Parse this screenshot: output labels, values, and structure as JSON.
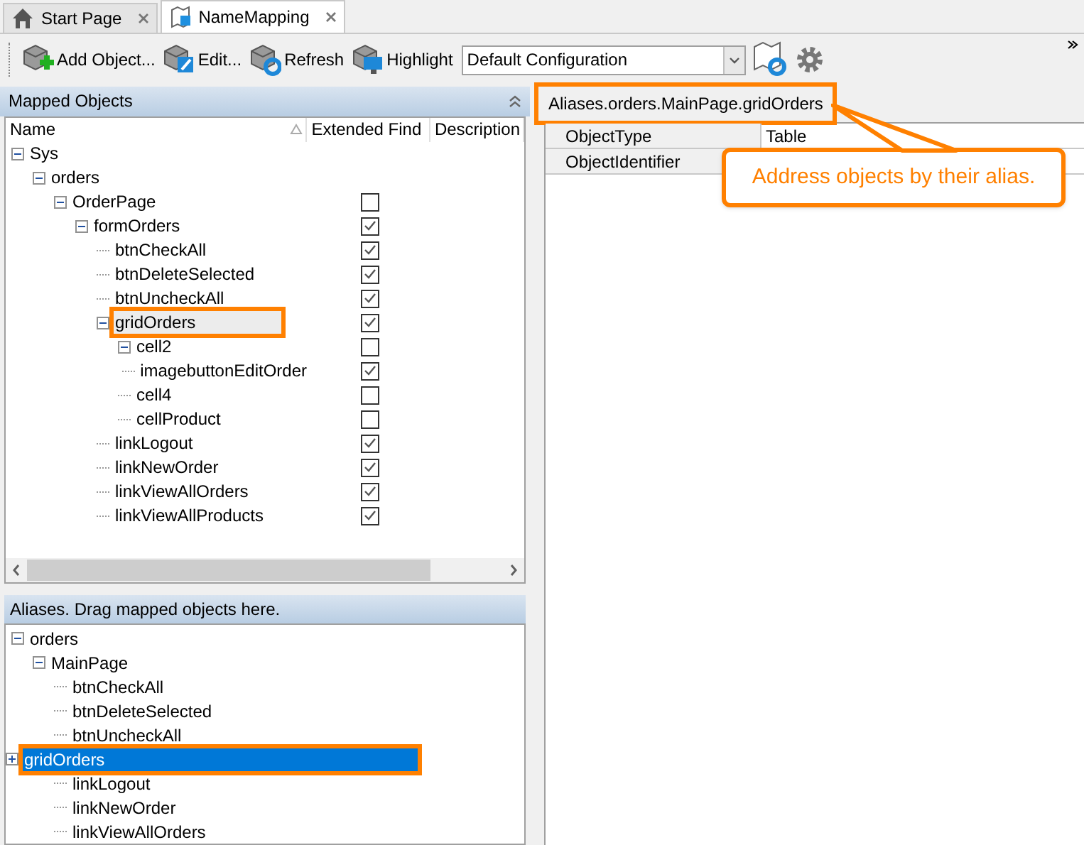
{
  "tabs": [
    {
      "label": "Start Page",
      "selected": false
    },
    {
      "label": "NameMapping",
      "selected": true
    }
  ],
  "toolbar": {
    "buttons": [
      {
        "label": "Add Object..."
      },
      {
        "label": "Edit..."
      },
      {
        "label": "Refresh"
      },
      {
        "label": "Highlight"
      }
    ],
    "configuration": "Default Configuration"
  },
  "mapped_objects": {
    "title": "Mapped Objects",
    "columns": [
      "Name",
      "Extended Find",
      "Description"
    ],
    "tree": [
      {
        "label": "Sys",
        "expanded": true,
        "selected": false,
        "annotated": false,
        "children": [
          {
            "label": "orders",
            "expanded": true,
            "selected": false,
            "annotated": false,
            "children": [
              {
                "label": "OrderPage",
                "expanded": true,
                "extended_find": false,
                "selected": false,
                "annotated": false,
                "children": [
                  {
                    "label": "formOrders",
                    "expanded": true,
                    "extended_find": true,
                    "selected": false,
                    "annotated": false,
                    "children": [
                      {
                        "label": "btnCheckAll",
                        "extended_find": true,
                        "selected": false,
                        "annotated": false
                      },
                      {
                        "label": "btnDeleteSelected",
                        "extended_find": true,
                        "selected": false,
                        "annotated": false
                      },
                      {
                        "label": "btnUncheckAll",
                        "extended_find": true,
                        "selected": false,
                        "annotated": false
                      },
                      {
                        "label": "gridOrders",
                        "expanded": true,
                        "extended_find": true,
                        "selected": true,
                        "annotated": true,
                        "children": [
                          {
                            "label": "cell2",
                            "expanded": true,
                            "extended_find": false,
                            "selected": false,
                            "annotated": false,
                            "children": [
                              {
                                "label": "imagebuttonEditOrder",
                                "extended_find": true,
                                "selected": false,
                                "annotated": false
                              }
                            ]
                          },
                          {
                            "label": "cell4",
                            "extended_find": false,
                            "selected": false,
                            "annotated": false
                          },
                          {
                            "label": "cellProduct",
                            "extended_find": false,
                            "selected": false,
                            "annotated": false
                          }
                        ]
                      },
                      {
                        "label": "linkLogout",
                        "extended_find": true,
                        "selected": false,
                        "annotated": false
                      },
                      {
                        "label": "linkNewOrder",
                        "extended_find": true,
                        "selected": false,
                        "annotated": false
                      },
                      {
                        "label": "linkViewAllOrders",
                        "extended_find": true,
                        "selected": false,
                        "annotated": false
                      },
                      {
                        "label": "linkViewAllProducts",
                        "extended_find": true,
                        "selected": false,
                        "annotated": false
                      }
                    ]
                  }
                ]
              }
            ]
          }
        ]
      }
    ]
  },
  "aliases": {
    "title": "Aliases. Drag mapped objects here.",
    "tree": [
      {
        "label": "orders",
        "expanded": true,
        "selected": false,
        "annotated": false,
        "children": [
          {
            "label": "MainPage",
            "expanded": true,
            "selected": false,
            "annotated": false,
            "children": [
              {
                "label": "btnCheckAll",
                "selected": false,
                "annotated": false
              },
              {
                "label": "btnDeleteSelected",
                "selected": false,
                "annotated": false
              },
              {
                "label": "btnUncheckAll",
                "selected": false,
                "annotated": false
              },
              {
                "label": "gridOrders",
                "expanded": false,
                "selected": true,
                "annotated": true
              },
              {
                "label": "linkLogout",
                "selected": false,
                "annotated": false
              },
              {
                "label": "linkNewOrder",
                "selected": false,
                "annotated": false
              },
              {
                "label": "linkViewAllOrders",
                "selected": false,
                "annotated": false
              }
            ]
          }
        ]
      }
    ]
  },
  "details": {
    "path": "Aliases.orders.MainPage.gridOrders",
    "properties": [
      {
        "name": "ObjectType",
        "value": "Table"
      },
      {
        "name": "ObjectIdentifier"
      }
    ]
  },
  "callout": "Address objects by their alias."
}
